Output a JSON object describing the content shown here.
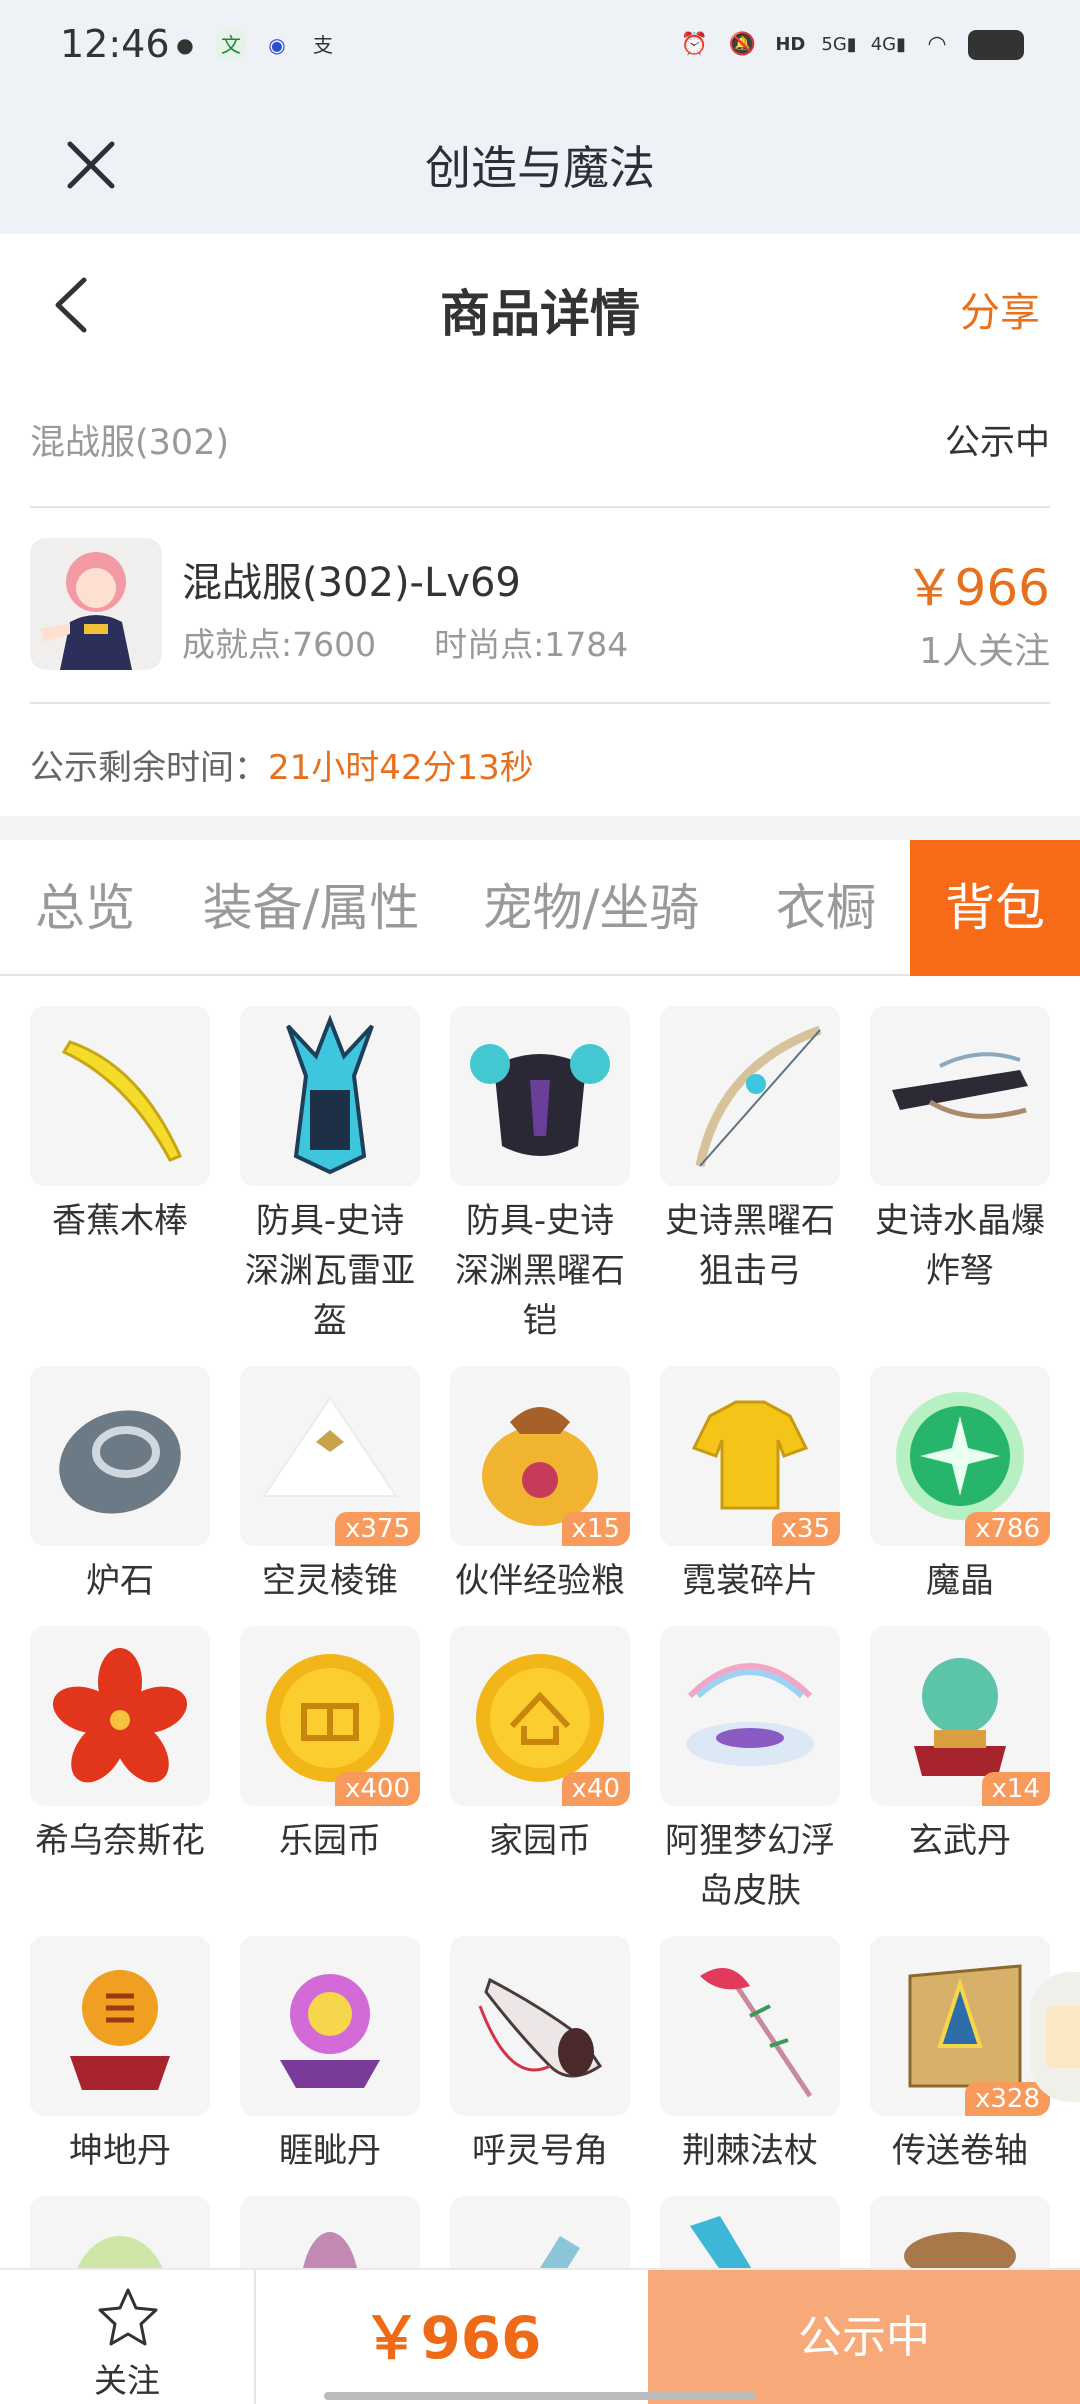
{
  "status_bar": {
    "time": "12:46",
    "apps": [
      "wechat-icon",
      "reader-icon",
      "record-icon",
      "alipay-icon"
    ],
    "indicators": [
      "alarm-icon",
      "mute-icon",
      "hd-icon",
      "5g-signal-icon",
      "4g-signal-icon",
      "wifi-icon",
      "battery-icon"
    ]
  },
  "app_title": "创造与魔法",
  "header": {
    "title": "商品详情",
    "share": "分享"
  },
  "server": {
    "name": "混战服(302)",
    "status": "公示中"
  },
  "item": {
    "name": "混战服(302)-Lv69",
    "achievement": "成就点:7600",
    "fashion": "时尚点:1784",
    "price": "￥966",
    "followers": "1人关注"
  },
  "countdown": {
    "label": "公示剩余时间：",
    "value": "21小时42分13秒"
  },
  "tabs": [
    "总览",
    "装备/属性",
    "宠物/坐骑",
    "衣橱",
    "背包"
  ],
  "active_tab": "背包",
  "inventory": [
    {
      "label": "香蕉木棒",
      "qty": "",
      "icon": "banana-club-icon"
    },
    {
      "label": "防具-史诗深渊瓦雷亚盔",
      "qty": "",
      "icon": "abyss-helmet-icon"
    },
    {
      "label": "防具-史诗深渊黑曜石铠",
      "qty": "",
      "icon": "abyss-armor-icon"
    },
    {
      "label": "史诗黑曜石狙击弓",
      "qty": "",
      "icon": "sniper-bow-icon"
    },
    {
      "label": "史诗水晶爆炸弩",
      "qty": "",
      "icon": "crystal-crossbow-icon"
    },
    {
      "label": "炉石",
      "qty": "",
      "icon": "hearthstone-icon"
    },
    {
      "label": "空灵棱锥",
      "qty": "x375",
      "icon": "pyramid-icon"
    },
    {
      "label": "伙伴经验粮",
      "qty": "x15",
      "icon": "food-bag-icon"
    },
    {
      "label": "霓裳碎片",
      "qty": "x35",
      "icon": "shirt-shard-icon"
    },
    {
      "label": "魔晶",
      "qty": "x786",
      "icon": "magic-crystal-icon"
    },
    {
      "label": "希乌奈斯花",
      "qty": "",
      "icon": "red-flower-icon"
    },
    {
      "label": "乐园币",
      "qty": "x400",
      "icon": "paradise-coin-icon"
    },
    {
      "label": "家园币",
      "qty": "x40",
      "icon": "home-coin-icon"
    },
    {
      "label": "阿狸梦幻浮岛皮肤",
      "qty": "",
      "icon": "floating-island-icon"
    },
    {
      "label": "玄武丹",
      "qty": "x14",
      "icon": "xuanwu-pill-icon"
    },
    {
      "label": "坤地丹",
      "qty": "",
      "icon": "kundi-pill-icon"
    },
    {
      "label": "睚眦丹",
      "qty": "",
      "icon": "yazi-pill-icon"
    },
    {
      "label": "呼灵号角",
      "qty": "",
      "icon": "horn-icon"
    },
    {
      "label": "荆棘法杖",
      "qty": "",
      "icon": "thorn-staff-icon"
    },
    {
      "label": "传送卷轴",
      "qty": "x328",
      "icon": "teleport-scroll-icon"
    }
  ],
  "bottom_bar": {
    "follow": "关注",
    "price": "￥966",
    "status": "公示中"
  },
  "colors": {
    "accent": "#e8701d",
    "tab_active": "#f76b18",
    "status_button": "#f8a979",
    "qty_badge": "#f79a5c"
  }
}
